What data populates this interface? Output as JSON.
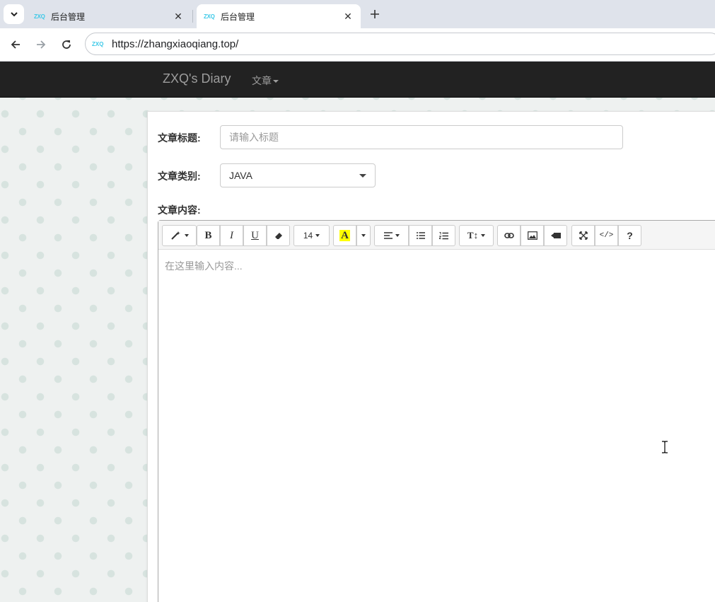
{
  "browser": {
    "tabs": [
      {
        "favicon": "ZXQ",
        "title": "后台管理",
        "active": false
      },
      {
        "favicon": "ZXQ",
        "title": "后台管理",
        "active": true
      }
    ],
    "new_tab_icon": "plus-icon",
    "url": "https://zhangxiaoqiang.top/",
    "url_favicon": "ZXQ"
  },
  "navbar": {
    "brand": "ZXQ's Diary",
    "menu_label": "文章"
  },
  "form": {
    "title_label": "文章标题:",
    "title_placeholder": "请输入标题",
    "title_value": "",
    "category_label": "文章类别:",
    "category_value": "JAVA",
    "content_label": "文章内容:"
  },
  "editor": {
    "placeholder": "在这里输入内容...",
    "font_size": "14",
    "tools": [
      "magic-style",
      "bold",
      "italic",
      "underline",
      "eraser",
      "font-size",
      "fore-color",
      "color-dropdown",
      "paragraph-align",
      "unordered-list",
      "ordered-list",
      "line-height",
      "link",
      "picture",
      "video",
      "fullscreen",
      "code-view",
      "help"
    ]
  },
  "colors": {
    "navbar_bg": "#222222",
    "navbar_text": "#9d9d9d",
    "highlight_yellow": "#ffff00",
    "favicon_cyan": "#3ec9e8"
  }
}
